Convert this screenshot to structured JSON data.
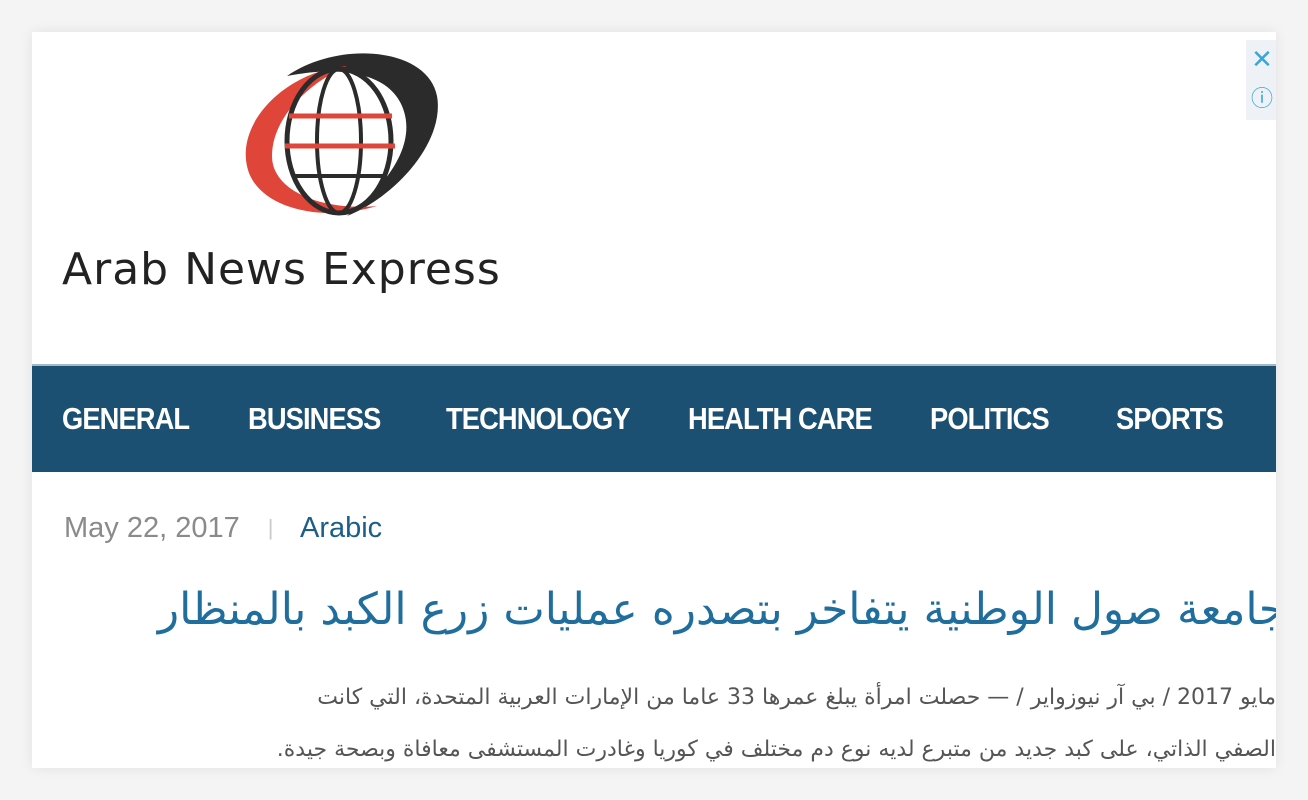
{
  "site": {
    "name": "Arab News Express",
    "logo_icon": "globe-swoosh-logo",
    "colors": {
      "logo_red": "#e0453a",
      "logo_dark": "#2b2b2b",
      "nav_bg": "#1b5073",
      "link": "#1b5e8a"
    }
  },
  "ad": {
    "close_icon": "close-icon",
    "info_icon": "info-icon",
    "close_glyph": "✕",
    "info_glyph": "ⓘ"
  },
  "nav": {
    "items": [
      {
        "label": "GENERAL"
      },
      {
        "label": "BUSINESS"
      },
      {
        "label": "TECHNOLOGY"
      },
      {
        "label": "HEALTH CARE"
      },
      {
        "label": "POLITICS"
      },
      {
        "label": "SPORTS"
      }
    ]
  },
  "article": {
    "date": "May 22, 2017",
    "separator": "|",
    "category": "Arabic",
    "title": "جامعة صول الوطنية يتفاخر بتصدره عمليات زرع الكبد بالمنظار",
    "body": [
      "مايو 2017 / بي آر نيوزواير / — حصلت امرأة يبلغ عمرها 33 عاما من الإمارات العربية المتحدة، التي كانت",
      "الصفي الذاتي، على كبد جديد من متبرع لديه نوع دم مختلف في كوريا وغادرت المستشفى معافاة وبصحة جيدة."
    ]
  }
}
